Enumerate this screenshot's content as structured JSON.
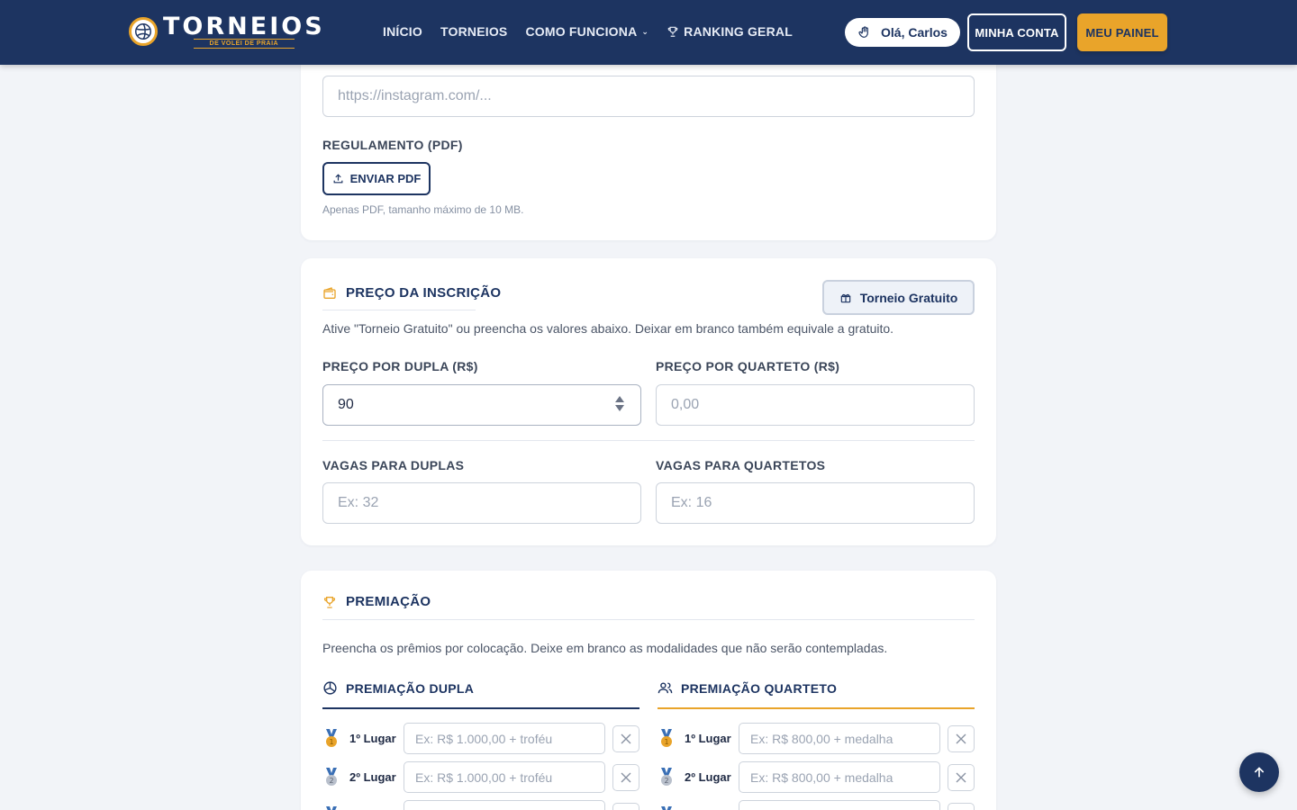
{
  "header": {
    "logo_main": "TORNEIOS",
    "logo_sub": "DE VOLEI DE PRAIA",
    "nav": [
      {
        "label": "INÍCIO"
      },
      {
        "label": "TORNEIOS"
      },
      {
        "label": "COMO FUNCIONA",
        "icon": "chevron-down-icon"
      },
      {
        "label": "RANKING GERAL",
        "icon": "trophy-icon"
      }
    ],
    "greeting": "Olá, Carlos",
    "account_label": "MINHA CONTA",
    "panel_label": "MEU PAINEL"
  },
  "links_section": {
    "instagram_placeholder": "https://instagram.com/...",
    "regulation_label": "REGULAMENTO (PDF)",
    "upload_label": "ENVIAR PDF",
    "upload_hint": "Apenas PDF, tamanho máximo de 10 MB."
  },
  "price_section": {
    "title": "PREÇO DA INSCRIÇÃO",
    "free_button": "Torneio Gratuito",
    "description": "Ative \"Torneio Gratuito\" ou preencha os valores abaixo. Deixar em branco também equivale a gratuito.",
    "pair_price_label": "PREÇO POR DUPLA (R$)",
    "pair_price_value": "90",
    "quartet_price_label": "PREÇO POR QUARTETO (R$)",
    "quartet_price_placeholder": "0,00",
    "pair_slots_label": "VAGAS PARA DUPLAS",
    "pair_slots_placeholder": "Ex: 32",
    "quartet_slots_label": "VAGAS PARA QUARTETOS",
    "quartet_slots_placeholder": "Ex: 16"
  },
  "prize_section": {
    "title": "PREMIAÇÃO",
    "description": "Preencha os prêmios por colocação. Deixe em branco as modalidades que não serão contempladas.",
    "pair": {
      "title": "PREMIAÇÃO DUPLA",
      "rows": [
        {
          "place": "1º Lugar",
          "placeholder": "Ex: R$ 1.000,00 + troféu"
        },
        {
          "place": "2º Lugar",
          "placeholder": "Ex: R$ 1.000,00 + troféu"
        }
      ]
    },
    "quartet": {
      "title": "PREMIAÇÃO QUARTETO",
      "rows": [
        {
          "place": "1º Lugar",
          "placeholder": "Ex: R$ 800,00 + medalha"
        },
        {
          "place": "2º Lugar",
          "placeholder": "Ex: R$ 800,00 + medalha"
        }
      ]
    }
  },
  "colors": {
    "primary": "#1d3461",
    "accent": "#e9a42a",
    "background": "#f2f4f8"
  }
}
